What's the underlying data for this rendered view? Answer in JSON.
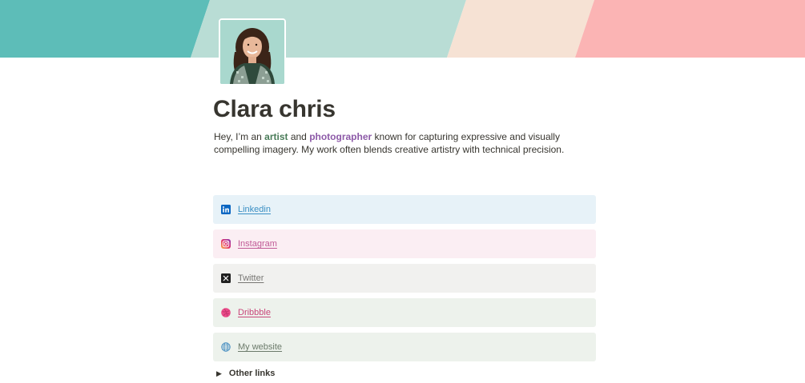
{
  "profile": {
    "name": "Clara chris",
    "bio_parts": [
      "Hey, I’m an ",
      "artist",
      " and ",
      "photographer",
      " known for capturing expressive and visually compelling imagery. My work often blends creative artistry with technical precision."
    ]
  },
  "banner_colors": [
    "#5dbdb8",
    "#b9ddd5",
    "#f6e2d4",
    "#fbb4b4"
  ],
  "links": [
    {
      "label": "Linkedin",
      "icon": "linkedin-icon",
      "bg": "#e7f2f8",
      "color": "#3a8fc4"
    },
    {
      "label": "Instagram",
      "icon": "instagram-icon",
      "bg": "#fbeef3",
      "color": "#c05a96"
    },
    {
      "label": "Twitter",
      "icon": "x-twitter-icon",
      "bg": "#f1f1ef",
      "color": "#787774"
    },
    {
      "label": "Dribbble",
      "icon": "dribbble-icon",
      "bg": "#edf2ec",
      "color": "#c9467a"
    },
    {
      "label": "My website",
      "icon": "globe-icon",
      "bg": "#edf2ec",
      "color": "#6b7a6a"
    }
  ],
  "toggle": {
    "label": "Other links",
    "icon": "triangle-right-icon"
  }
}
